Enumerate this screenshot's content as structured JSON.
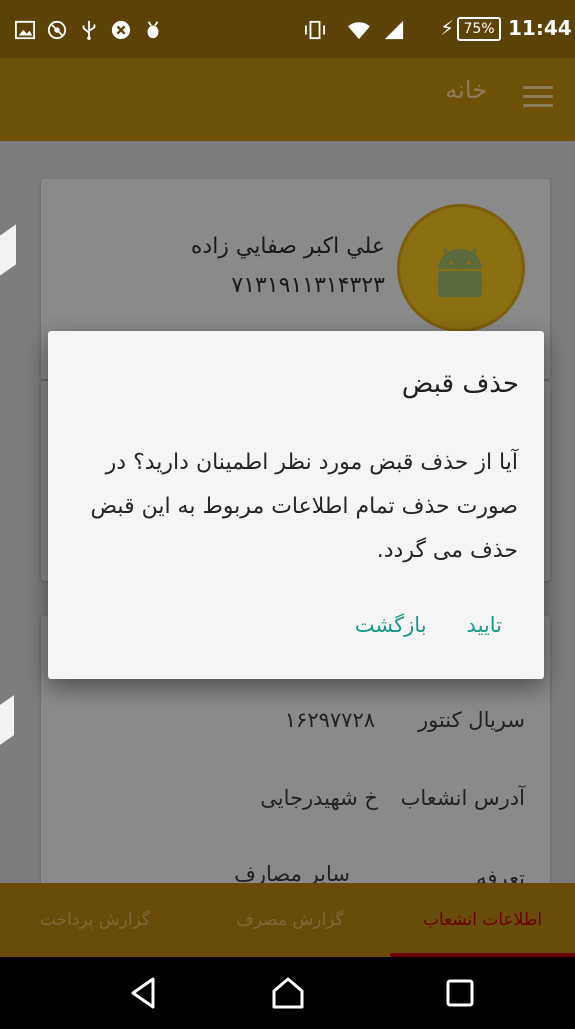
{
  "status_bar": {
    "battery": "75%",
    "time": "11:44"
  },
  "app_bar": {
    "title": "خانه"
  },
  "profile": {
    "name": "علي اكبر صفايي زاده",
    "id": "۷۱۳۱۹۱۱۳۱۴۳۲۳"
  },
  "details": {
    "rows": [
      {
        "label": "سریال کنتور",
        "value": "۱۶۲۹۷۷۲۸"
      },
      {
        "label": "آدرس انشعاب",
        "value": "خ شهیدرجایی"
      },
      {
        "label": "تعرفه",
        "value": "سایر مصارف"
      }
    ]
  },
  "bottom_nav": {
    "tabs": [
      "اطلاعات انشعاب",
      "گزارش مصرف",
      "گزارش پرداخت"
    ]
  },
  "dialog": {
    "title": "حذف قبض",
    "message": "آیا از حذف قبض مورد نظر اطمینان دارید؟ در صورت حذف تمام اطلاعات مربوط به این قبض حذف می گردد.",
    "confirm_label": "تایید",
    "back_label": "بازگشت"
  },
  "colors": {
    "app_bar": "#6e5209",
    "accent": "#1a9a88",
    "active_tab": "#6b0000"
  }
}
